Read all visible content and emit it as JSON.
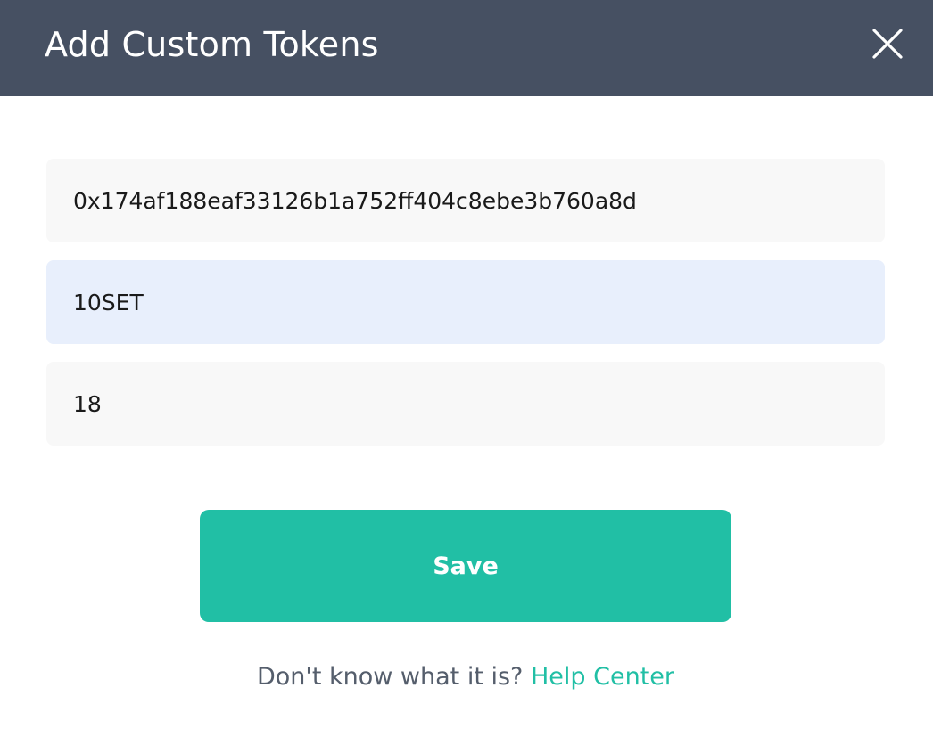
{
  "header": {
    "title": "Add Custom Tokens",
    "close_icon": "close-icon",
    "background_color": "#465062"
  },
  "form": {
    "contract_address": {
      "value": "0x174af188eaf33126b1a752ff404c8ebe3b760a8d"
    },
    "token_symbol": {
      "value": "10SET"
    },
    "decimals": {
      "value": "18"
    }
  },
  "save_button": {
    "label": "Save",
    "color": "#21bfa5"
  },
  "help": {
    "prompt": "Don't know what it is?",
    "link_label": "Help Center",
    "link_color": "#21bfa5"
  }
}
